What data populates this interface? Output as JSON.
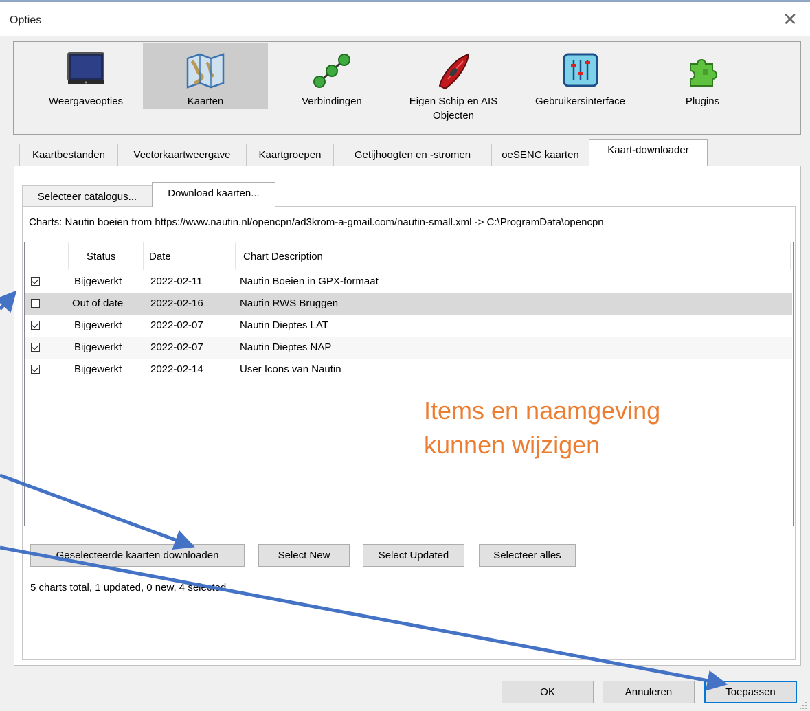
{
  "window": {
    "title": "Opties",
    "close_symbol": "✕"
  },
  "categories": [
    {
      "label": "Weergaveopties",
      "icon": "monitor-icon",
      "selected": false
    },
    {
      "label": "Kaarten",
      "icon": "charts-map-icon",
      "selected": true
    },
    {
      "label": "Verbindingen",
      "icon": "connections-icon",
      "selected": false
    },
    {
      "label": "Eigen Schip en AIS Objecten",
      "icon": "ship-icon",
      "selected": false
    },
    {
      "label": "Gebruikersinterface",
      "icon": "sliders-icon",
      "selected": false
    },
    {
      "label": "Plugins",
      "icon": "puzzle-icon",
      "selected": false
    }
  ],
  "tabs": [
    "Kaartbestanden",
    "Vectorkaartweergave",
    "Kaartgroepen",
    "Getijhoogten en -stromen",
    "oeSENC kaarten",
    "Kaart-downloader"
  ],
  "active_tab": "Kaart-downloader",
  "subtabs": [
    "Selecteer catalogus...",
    "Download kaarten..."
  ],
  "active_subtab": "Download kaarten...",
  "charts_info": "Charts: Nautin boeien from https://www.nautin.nl/opencpn/ad3krom-a-gmail.com/nautin-small.xml -> C:\\ProgramData\\opencpn",
  "list": {
    "columns": [
      "Status",
      "Date",
      "Chart Description"
    ],
    "rows": [
      {
        "checked": true,
        "status": "Bijgewerkt",
        "date": "2022-02-11",
        "description": "Nautin Boeien in GPX-formaat"
      },
      {
        "checked": false,
        "status": "Out of date",
        "date": "2022-02-16",
        "description": "Nautin RWS Bruggen"
      },
      {
        "checked": true,
        "status": "Bijgewerkt",
        "date": "2022-02-07",
        "description": "Nautin Dieptes LAT"
      },
      {
        "checked": true,
        "status": "Bijgewerkt",
        "date": "2022-02-07",
        "description": "Nautin Dieptes NAP"
      },
      {
        "checked": true,
        "status": "Bijgewerkt",
        "date": "2022-02-14",
        "description": "User Icons van Nautin"
      }
    ]
  },
  "annotation": {
    "line1": "Items en naamgeving",
    "line2": "kunnen wijzigen",
    "color": "#ed7d31"
  },
  "actions": {
    "download": "Geselecteerde kaarten downloaden",
    "select_new": "Select New",
    "select_updated": "Select Updated",
    "select_all": "Selecteer alles"
  },
  "status_text": "5 charts total, 1 updated, 0 new, 4 selected",
  "footer": {
    "ok": "OK",
    "cancel": "Annuleren",
    "apply": "Toepassen"
  },
  "colors": {
    "arrow": "#4472c4",
    "selected_category": "#cccccc",
    "highlight_row": "#d9d9d9"
  }
}
